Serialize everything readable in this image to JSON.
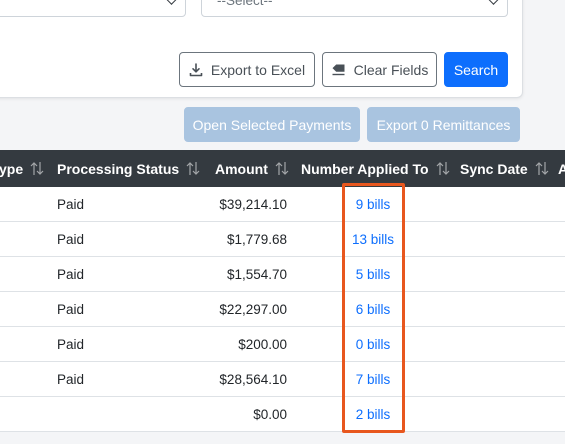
{
  "filters": {
    "select_right_value": "--Select--"
  },
  "actions": {
    "export_excel": "Export to Excel",
    "clear_fields": "Clear Fields",
    "search": "Search",
    "open_selected_payments": "Open Selected Payments",
    "export_remittances": "Export 0 Remittances"
  },
  "table": {
    "columns": {
      "type": "ype",
      "processing_status": "Processing Status",
      "amount": "Amount",
      "number_applied_to": "Number Applied To",
      "sync_date": "Sync Date",
      "next": "A"
    },
    "rows": [
      {
        "status": "Paid",
        "amount": "$39,214.10",
        "applied": "9 bills"
      },
      {
        "status": "Paid",
        "amount": "$1,779.68",
        "applied": "13 bills"
      },
      {
        "status": "Paid",
        "amount": "$1,554.70",
        "applied": "5 bills"
      },
      {
        "status": "Paid",
        "amount": "$22,297.00",
        "applied": "6 bills"
      },
      {
        "status": "Paid",
        "amount": "$200.00",
        "applied": "0 bills"
      },
      {
        "status": "Paid",
        "amount": "$28,564.10",
        "applied": "7 bills"
      },
      {
        "status": "",
        "amount": "$0.00",
        "applied": "2 bills"
      }
    ]
  },
  "icons": {
    "export": "download-icon",
    "clear": "eraser-icon",
    "sort": "sort-arrows-icon"
  },
  "colors": {
    "primary": "#0d6efd",
    "primary_disabled": "#a9c4e0",
    "header_bg": "#343a40",
    "link": "#0d6efd",
    "highlight": "#e8571e"
  }
}
